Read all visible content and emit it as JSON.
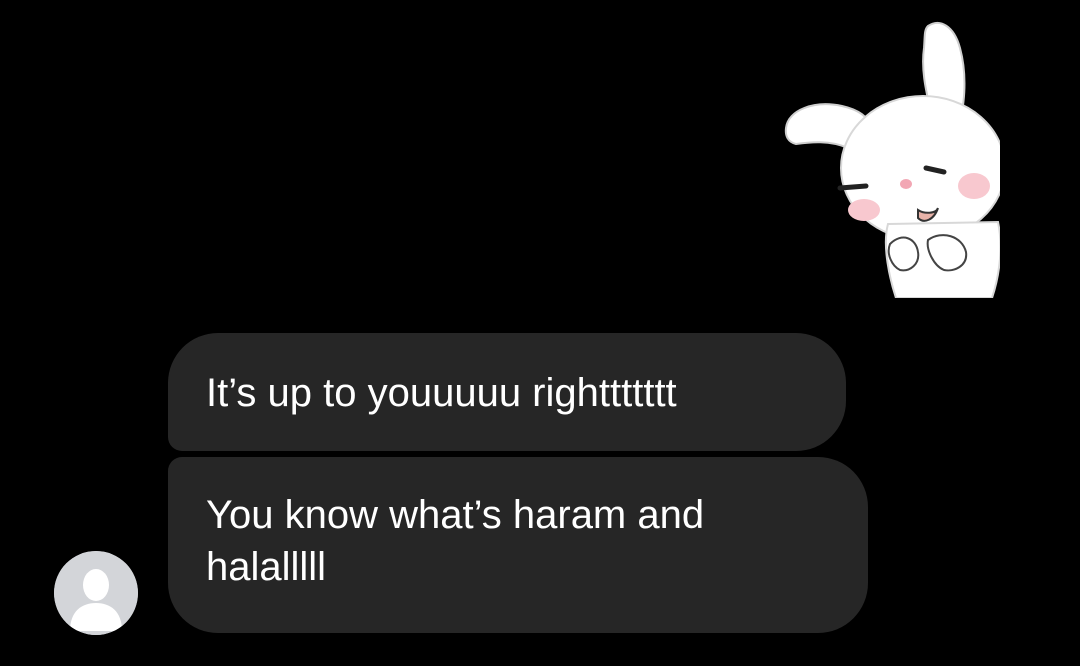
{
  "conversation": {
    "messages": [
      {
        "text": "It’s up to youuuuu righttttttt"
      },
      {
        "text": "You know what’s haram and halalllll"
      }
    ],
    "sticker": {
      "icon": "bunny-sticker-icon"
    },
    "avatar": {
      "icon": "default-user-avatar-icon"
    }
  },
  "colors": {
    "background": "#000000",
    "bubble": "#262626",
    "text": "#ffffff",
    "avatar_bg": "#d3d5d9",
    "avatar_fg": "#ffffff"
  }
}
